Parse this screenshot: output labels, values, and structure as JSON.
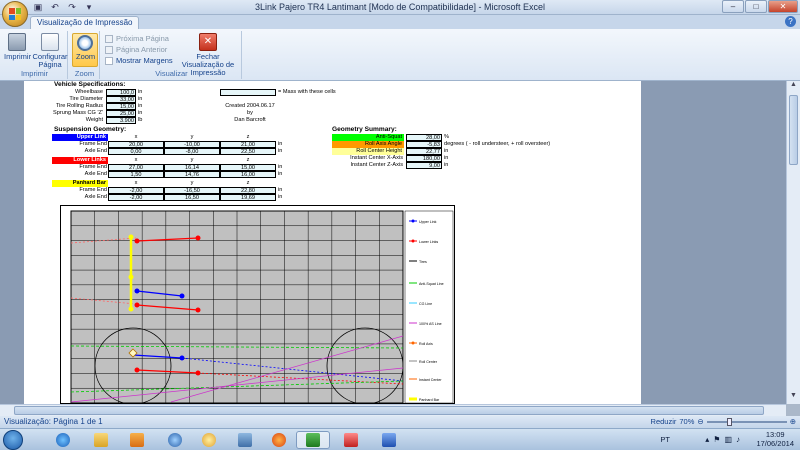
{
  "window": {
    "title": "3Link Pajero TR4 Lantimant  [Modo de Compatibilidade] - Microsoft Excel",
    "minimize": "–",
    "maximize": "□",
    "close": "✕"
  },
  "ribbon": {
    "tab": "Visualização de Impressão",
    "groups": {
      "imprimir": "Imprimir",
      "zoom": "Zoom",
      "visualizar": "Visualizar"
    },
    "buttons": {
      "imprimir": "Imprimir",
      "configurar": "Configurar Página",
      "zoom": "Zoom",
      "proxima": "Próxima Página",
      "anterior": "Página Anterior",
      "mostrar_margens": "Mostrar Margens",
      "fechar": "Fechar Visualização de Impressão"
    }
  },
  "sheet": {
    "vehicle_title": "Vehicle Specifications:",
    "vehicle_rows": [
      {
        "label": "Wheelbase",
        "value": "100,0",
        "unit": "in"
      },
      {
        "label": "Tire Diameter",
        "value": "33,00",
        "unit": "in"
      },
      {
        "label": "Tire Rolling Radius",
        "value": "15,00",
        "unit": "in"
      },
      {
        "label": "Sprung Mass CG 'Z'",
        "value": "25,00",
        "unit": "in"
      },
      {
        "label": "Weight",
        "value": "3.900",
        "unit": "lb"
      }
    ],
    "mass_note": "= Mass with these cells",
    "created": "Created 2004.06.17",
    "by": "by",
    "author": "Dan Barcroft",
    "suspension_title": "Suspension Geometry:",
    "upper_link": {
      "label": "Upper Link",
      "rows": [
        {
          "label": "Frame End",
          "x": "20,00",
          "y": "-10,00",
          "z": "21,00",
          "unit": "in"
        },
        {
          "label": "Axle End",
          "x": "0,00",
          "y": "-8,00",
          "z": "22,50",
          "unit": "in"
        }
      ]
    },
    "lower_links": {
      "label": "Lower Links",
      "rows": [
        {
          "label": "Frame End",
          "x": "27,00",
          "y": "16,14",
          "z": "15,00",
          "unit": "in"
        },
        {
          "label": "Axle End",
          "x": "1,50",
          "y": "14,76",
          "z": "16,00",
          "unit": "in"
        }
      ]
    },
    "panhard_bar": {
      "label": "Panhard Bar",
      "rows": [
        {
          "label": "Frame End",
          "x": "-2,00",
          "y": "-16,50",
          "z": "22,80",
          "unit": "in"
        },
        {
          "label": "Axle End",
          "x": "-2,00",
          "y": "16,50",
          "z": "19,69",
          "unit": "in"
        }
      ]
    },
    "col_headers": {
      "x": "x",
      "y": "y",
      "z": "z"
    },
    "geometry_title": "Geometry Summary:",
    "geometry_rows": [
      {
        "label": "Anti-Squat",
        "value": "28,00",
        "unit": "%",
        "style": "green"
      },
      {
        "label": "Roll Axis Angle",
        "value": "-5,83",
        "unit": "degrees ( - roll understeer, + roll oversteer)",
        "style": "orange"
      },
      {
        "label": "Roll Center Height",
        "value": "22,77",
        "unit": "in",
        "style": "ltyel"
      },
      {
        "label": "Instant Center X-Axis",
        "value": "180,00",
        "unit": "in",
        "style": "none"
      },
      {
        "label": "Instant Center Z-Axis",
        "value": "9,00",
        "unit": "in",
        "style": "none"
      }
    ]
  },
  "chart_data": {
    "type": "scatter",
    "legend": [
      "Upper Link",
      "Lower Links",
      "Tires",
      "Anti-Squat Line",
      "CG Line",
      "100% AS Line",
      "Roll Axis",
      "Roll Center",
      "Instant Center",
      "Panhard Bar"
    ],
    "colors": {
      "upper": "#0000ff",
      "lower": "#ff0000",
      "tires": "#000000",
      "as": "#00cc00",
      "cg": "#33ccff",
      "as100": "#cc33cc",
      "roll": "#ff6600",
      "panhard": "#ffff00",
      "dotted_red": "#ff6666"
    },
    "plot_bg": "#c0c0c0"
  },
  "status": {
    "page": "Visualização: Página 1 de 1",
    "zoom_label": "Reduzir",
    "zoom_pct": "70%"
  },
  "taskbar": {
    "lang": "PT",
    "time": "13:09",
    "date": "17/06/2014"
  }
}
